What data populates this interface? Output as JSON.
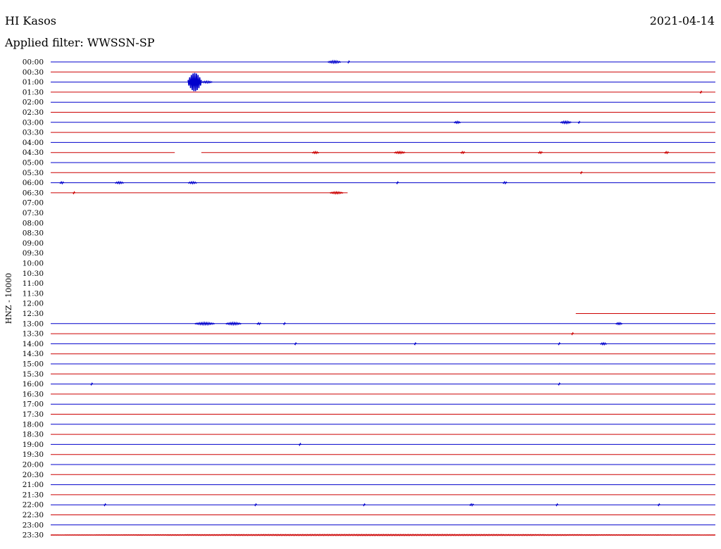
{
  "header": {
    "station": "HI Kasos",
    "date": "2021-04-14",
    "filter_text": "Applied filter: WWSSN-SP"
  },
  "chart_data": {
    "type": "line",
    "title": "HI Kasos",
    "subtitle": "Applied filter: WWSSN-SP",
    "ylabel": "HNZ - 10000",
    "row_interval_minutes": 30,
    "x_range_minutes": [
      0,
      30
    ],
    "colors": {
      "even_row": "#0000cc",
      "odd_row": "#cc0000"
    },
    "tick_labels": [
      "00:00",
      "00:30",
      "01:00",
      "01:30",
      "02:00",
      "02:30",
      "03:00",
      "03:30",
      "04:00",
      "04:30",
      "05:00",
      "05:30",
      "06:00",
      "06:30",
      "07:00",
      "07:30",
      "08:00",
      "08:30",
      "09:00",
      "09:30",
      "10:00",
      "10:30",
      "11:00",
      "11:30",
      "12:00",
      "12:30",
      "13:00",
      "13:30",
      "14:00",
      "14:30",
      "15:00",
      "15:30",
      "16:00",
      "16:30",
      "17:00",
      "17:30",
      "18:00",
      "18:30",
      "19:00",
      "19:30",
      "20:00",
      "20:30",
      "21:00",
      "21:30",
      "22:00",
      "22:30",
      "23:00",
      "23:30"
    ],
    "traces": [
      {
        "row": "00:00",
        "segments": [
          [
            0,
            30
          ]
        ],
        "events": [
          {
            "t": 12.5,
            "dur": 0.6,
            "amp": 1.2
          },
          {
            "t": 13.4,
            "dur": 0.1,
            "amp": 1.0
          }
        ]
      },
      {
        "row": "00:30",
        "segments": [
          [
            0,
            30
          ]
        ],
        "events": []
      },
      {
        "row": "01:00",
        "segments": [
          [
            0,
            30
          ]
        ],
        "events": [
          {
            "t": 6.2,
            "dur": 0.6,
            "amp": 10
          },
          {
            "t": 6.8,
            "dur": 0.5,
            "amp": 1
          }
        ]
      },
      {
        "row": "01:30",
        "segments": [
          [
            0,
            30
          ]
        ],
        "events": [
          {
            "t": 29.3,
            "dur": 0.1,
            "amp": 1
          }
        ]
      },
      {
        "row": "02:00",
        "segments": [
          [
            0,
            30
          ]
        ],
        "events": []
      },
      {
        "row": "02:30",
        "segments": [
          [
            0,
            30
          ]
        ],
        "events": []
      },
      {
        "row": "03:00",
        "segments": [
          [
            0,
            30
          ]
        ],
        "events": [
          {
            "t": 18.2,
            "dur": 0.3,
            "amp": 1
          },
          {
            "t": 23.0,
            "dur": 0.5,
            "amp": 1.2
          },
          {
            "t": 23.8,
            "dur": 0.1,
            "amp": 1
          }
        ]
      },
      {
        "row": "03:30",
        "segments": [
          [
            0,
            30
          ]
        ],
        "events": []
      },
      {
        "row": "04:00",
        "segments": [
          [
            0,
            30
          ]
        ],
        "events": []
      },
      {
        "row": "04:30",
        "segments": [
          [
            0,
            5.6
          ],
          [
            6.8,
            30
          ]
        ],
        "events": [
          {
            "t": 11.8,
            "dur": 0.3,
            "amp": 1
          },
          {
            "t": 15.5,
            "dur": 0.5,
            "amp": 1
          },
          {
            "t": 18.5,
            "dur": 0.2,
            "amp": 1
          },
          {
            "t": 22.0,
            "dur": 0.2,
            "amp": 1
          },
          {
            "t": 27.7,
            "dur": 0.2,
            "amp": 1
          }
        ]
      },
      {
        "row": "05:00",
        "segments": [
          [
            0,
            30
          ]
        ],
        "events": []
      },
      {
        "row": "05:30",
        "segments": [
          [
            0,
            30
          ]
        ],
        "events": [
          {
            "t": 23.9,
            "dur": 0.1,
            "amp": 1
          }
        ]
      },
      {
        "row": "06:00",
        "segments": [
          [
            0,
            30
          ]
        ],
        "events": [
          {
            "t": 0.4,
            "dur": 0.2,
            "amp": 1
          },
          {
            "t": 2.9,
            "dur": 0.4,
            "amp": 1
          },
          {
            "t": 6.2,
            "dur": 0.4,
            "amp": 1
          },
          {
            "t": 15.6,
            "dur": 0.1,
            "amp": 1
          },
          {
            "t": 20.4,
            "dur": 0.2,
            "amp": 1
          }
        ]
      },
      {
        "row": "06:30",
        "segments": [
          [
            0,
            13.4
          ]
        ],
        "events": [
          {
            "t": 1.0,
            "dur": 0.1,
            "amp": 1
          },
          {
            "t": 12.6,
            "dur": 0.6,
            "amp": 1
          }
        ]
      },
      {
        "row": "07:00",
        "segments": [],
        "events": []
      },
      {
        "row": "07:30",
        "segments": [],
        "events": []
      },
      {
        "row": "08:00",
        "segments": [],
        "events": []
      },
      {
        "row": "08:30",
        "segments": [],
        "events": []
      },
      {
        "row": "09:00",
        "segments": [],
        "events": []
      },
      {
        "row": "09:30",
        "segments": [],
        "events": []
      },
      {
        "row": "10:00",
        "segments": [],
        "events": []
      },
      {
        "row": "10:30",
        "segments": [],
        "events": []
      },
      {
        "row": "11:00",
        "segments": [],
        "events": []
      },
      {
        "row": "11:30",
        "segments": [],
        "events": []
      },
      {
        "row": "12:00",
        "segments": [],
        "events": []
      },
      {
        "row": "12:30",
        "segments": [
          [
            23.7,
            30
          ]
        ],
        "events": []
      },
      {
        "row": "13:00",
        "segments": [
          [
            0,
            30
          ]
        ],
        "events": [
          {
            "t": 6.5,
            "dur": 0.9,
            "amp": 1.2
          },
          {
            "t": 7.9,
            "dur": 0.7,
            "amp": 1.2
          },
          {
            "t": 9.3,
            "dur": 0.2,
            "amp": 1
          },
          {
            "t": 10.5,
            "dur": 0.1,
            "amp": 1
          },
          {
            "t": 25.5,
            "dur": 0.3,
            "amp": 1
          }
        ]
      },
      {
        "row": "13:30",
        "segments": [
          [
            0,
            30
          ]
        ],
        "events": [
          {
            "t": 23.5,
            "dur": 0.1,
            "amp": 1
          }
        ]
      },
      {
        "row": "14:00",
        "segments": [
          [
            0,
            30
          ]
        ],
        "events": [
          {
            "t": 11.0,
            "dur": 0.1,
            "amp": 1
          },
          {
            "t": 16.4,
            "dur": 0.1,
            "amp": 1
          },
          {
            "t": 22.9,
            "dur": 0.1,
            "amp": 1
          },
          {
            "t": 24.8,
            "dur": 0.3,
            "amp": 1
          }
        ]
      },
      {
        "row": "14:30",
        "segments": [
          [
            0,
            30
          ]
        ],
        "events": []
      },
      {
        "row": "15:00",
        "segments": [
          [
            0,
            30
          ]
        ],
        "events": []
      },
      {
        "row": "15:30",
        "segments": [
          [
            0,
            30
          ]
        ],
        "events": []
      },
      {
        "row": "16:00",
        "segments": [
          [
            0,
            30
          ]
        ],
        "events": [
          {
            "t": 1.8,
            "dur": 0.1,
            "amp": 1
          },
          {
            "t": 22.9,
            "dur": 0.1,
            "amp": 1
          }
        ]
      },
      {
        "row": "16:30",
        "segments": [
          [
            0,
            30
          ]
        ],
        "events": []
      },
      {
        "row": "17:00",
        "segments": [
          [
            0,
            30
          ]
        ],
        "events": []
      },
      {
        "row": "17:30",
        "segments": [
          [
            0,
            30
          ]
        ],
        "events": []
      },
      {
        "row": "18:00",
        "segments": [
          [
            0,
            30
          ]
        ],
        "events": []
      },
      {
        "row": "18:30",
        "segments": [
          [
            0,
            30
          ]
        ],
        "events": []
      },
      {
        "row": "19:00",
        "segments": [
          [
            0,
            30
          ]
        ],
        "events": [
          {
            "t": 11.2,
            "dur": 0.1,
            "amp": 1
          }
        ]
      },
      {
        "row": "19:30",
        "segments": [
          [
            0,
            30
          ]
        ],
        "events": []
      },
      {
        "row": "20:00",
        "segments": [
          [
            0,
            30
          ]
        ],
        "events": []
      },
      {
        "row": "20:30",
        "segments": [
          [
            0,
            30
          ]
        ],
        "events": []
      },
      {
        "row": "21:00",
        "segments": [
          [
            0,
            30
          ]
        ],
        "events": []
      },
      {
        "row": "21:30",
        "segments": [
          [
            0,
            30
          ]
        ],
        "events": []
      },
      {
        "row": "22:00",
        "segments": [
          [
            0,
            30
          ]
        ],
        "events": [
          {
            "t": 2.4,
            "dur": 0.1,
            "amp": 1
          },
          {
            "t": 9.2,
            "dur": 0.1,
            "amp": 1
          },
          {
            "t": 14.1,
            "dur": 0.1,
            "amp": 1
          },
          {
            "t": 18.9,
            "dur": 0.2,
            "amp": 1
          },
          {
            "t": 22.8,
            "dur": 0.1,
            "amp": 1
          },
          {
            "t": 27.4,
            "dur": 0.1,
            "amp": 1
          }
        ]
      },
      {
        "row": "22:30",
        "segments": [
          [
            0,
            30
          ]
        ],
        "events": []
      },
      {
        "row": "23:00",
        "segments": [
          [
            0,
            30
          ]
        ],
        "events": []
      },
      {
        "row": "23:30",
        "segments": [
          [
            0,
            30
          ]
        ],
        "events": [
          {
            "t": 0.0,
            "dur": 30,
            "amp": 0.6
          }
        ]
      }
    ]
  }
}
